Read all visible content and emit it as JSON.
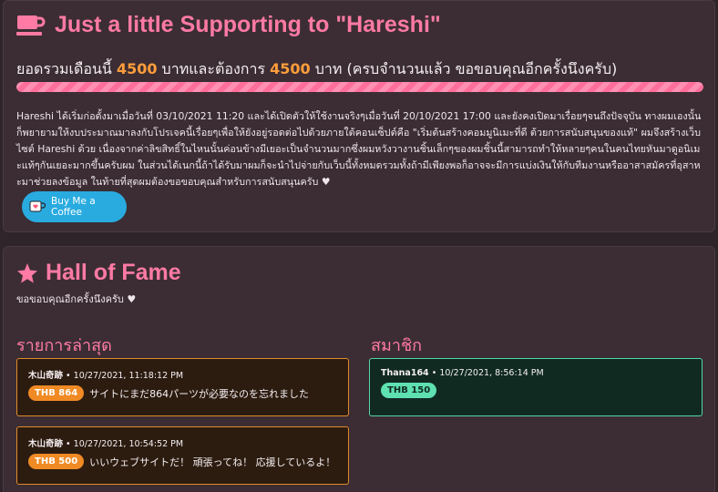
{
  "support": {
    "title": "Just a little Supporting to \"Hareshi\"",
    "summary_prefix": "ยอดรวมเดือนนี้ ",
    "current_amount": "4500",
    "summary_middle": " บาทและต้องการ ",
    "target_amount": "4500",
    "summary_suffix": " บาท (ครบจำนวนแล้ว ขอขอบคุณอีกครั้งนึงครับ)",
    "progress_fraction": 1.0,
    "description": "Hareshi ได้เริ่มก่อตั้งมาเมื่อวันที่ 03/10/2021 11:20 และได้เปิดตัวให้ใช้งานจริงๆเมื่อวันที่ 20/10/2021 17:00 และยังคงเปิดมาเรื่อยๆจนถึงปัจจุบัน ทางผมเองนั้นก็พยายามให้งบประมาณมาลงกับโปรเจคนี้เรื่อยๆเพื่อให้ยังอยู่รอดต่อไปด้วยภายใต้คอนเซ็ปต์คือ \"เริ่มต้นสร้างคอมมูนิเมะที่ดี ด้วยการสนับสนุนของแท้\" ผมจึงสร้างเว็บไซต์ Hareshi ด้วย เนื่องจากค่าลิขสิทธิ์ในไหนนั้นค่อนข้างมีเยอะเป็นจำนวนมากซึ่งผมหวังวางานชิ้นเล็กๆของผมชิ้นนี้สามารถทำให้หลายๆคนในคนไทยหันมาดูอนิเมะแท้ๆกันเยอะมากขึ้นครับผม ในส่วนได้เนกนี้ถ้าได้รับมาผมก็จะนำไปจ่ายกับเว็บนี้ทั้งหมดรวมทั้งถ้ามีเพียงพอก็อาจจะมีการแบ่งเงินให้กับทีมงานหรืออาสาสมัครที่อุสาหะมาช่วยลงข้อมูล ในท้ายที่สุดผมต้องขอขอบคุณสำหรับการสนับสนุนครับ",
    "heart": "♥",
    "bmc_label": "Buy Me a Coffee"
  },
  "fame": {
    "title": "Hall of Fame",
    "subtitle": "ขอขอบคุณอีกครั้งนึงครับ",
    "heart": "♥",
    "latest_title": "รายการล่าสุด",
    "members_title": "สมาชิก",
    "latest": [
      {
        "name": "木山奇跡",
        "time": " • 10/27/2021, 11:18:12 PM",
        "amount": "THB 864",
        "message": "サイトにまだ864パーツが必要なのを忘れました"
      },
      {
        "name": "木山奇跡",
        "time": " • 10/27/2021, 10:54:52 PM",
        "amount": "THB 500",
        "message": "いいウェブサイトだ！ 頑張ってね！ 応援しているよ！"
      }
    ],
    "members": [
      {
        "name": "Thana164",
        "time": " • 10/27/2021, 8:56:14 PM",
        "amount": "THB 150",
        "message": ""
      }
    ]
  },
  "colors": {
    "accent_pink": "#ff7aa4",
    "amount_orange": "#ff9d3b",
    "bmc_blue": "#29abe0",
    "member_green": "#5fe0b1"
  }
}
